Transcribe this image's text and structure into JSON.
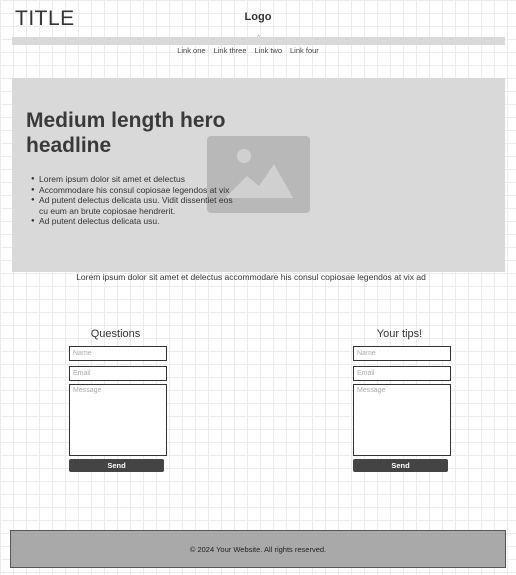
{
  "header": {
    "title": "TITLE",
    "logo": "Logo",
    "nav_caret": "^"
  },
  "nav": {
    "links": [
      "Link one",
      "Link three",
      "Link two",
      "Link four"
    ]
  },
  "hero": {
    "headline": "Medium length hero headline",
    "image_icon": "image-placeholder-icon",
    "bullets": [
      "Lorem ipsum dolor sit amet et delectus",
      "Accommodare his consul copiosae legendos at vix",
      "Ad putent delectus delicata usu. Vidit dissentiet eos cu eum an brute copiosae hendrerit.",
      "Ad putent delectus delicata usu."
    ]
  },
  "subtext": "Lorem ipsum dolor sit amet et delectus accommodare his consul copiosae legendos at vix ad",
  "forms": [
    {
      "title": "Questions",
      "name_placeholder": "Name",
      "email_placeholder": "Email",
      "message_placeholder": "Message",
      "send_label": "Send"
    },
    {
      "title": "Your tips!",
      "name_placeholder": "Name",
      "email_placeholder": "Email",
      "message_placeholder": "Message",
      "send_label": "Send"
    }
  ],
  "footer": {
    "text": "© 2024 Your Website. All rights reserved."
  },
  "colors": {
    "placeholder_block": "#d9d9d9",
    "image_block": "#b8b8b8",
    "button": "#444444",
    "footer": "#a9a9a9"
  }
}
